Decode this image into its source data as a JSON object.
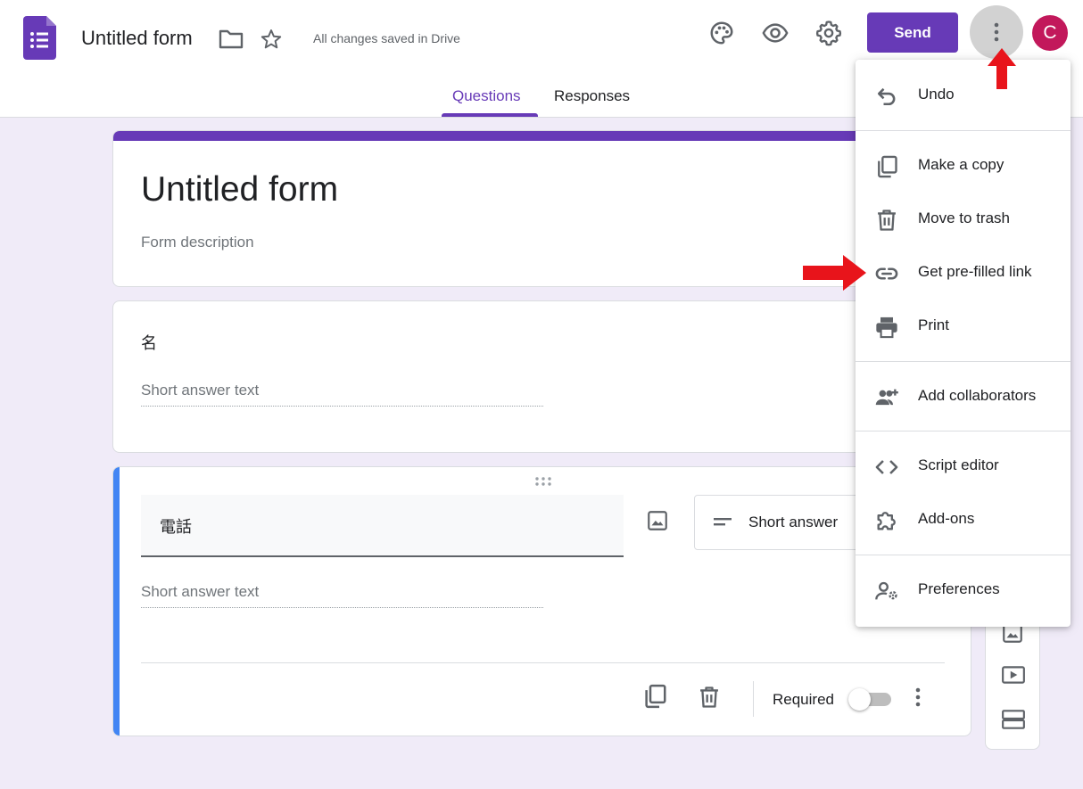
{
  "header": {
    "title": "Untitled form",
    "save_status": "All changes saved in Drive",
    "send_label": "Send",
    "avatar_initial": "C",
    "tabs": [
      {
        "label": "Questions",
        "active": true
      },
      {
        "label": "Responses",
        "active": false
      }
    ]
  },
  "form": {
    "title": "Untitled form",
    "description_placeholder": "Form description"
  },
  "questions": [
    {
      "title": "名",
      "answer_placeholder": "Short answer text"
    },
    {
      "title": "電話",
      "answer_placeholder": "Short answer text",
      "type": "Short answer",
      "required_label": "Required",
      "required": false
    }
  ],
  "menu": {
    "items": [
      {
        "label": "Undo",
        "icon": "undo-icon"
      },
      {
        "label": "Make a copy",
        "icon": "copy-icon"
      },
      {
        "label": "Move to trash",
        "icon": "trash-icon"
      },
      {
        "label": "Get pre-filled link",
        "icon": "link-icon"
      },
      {
        "label": "Print",
        "icon": "print-icon"
      },
      {
        "label": "Add collaborators",
        "icon": "add-people-icon"
      },
      {
        "label": "Script editor",
        "icon": "code-icon"
      },
      {
        "label": "Add-ons",
        "icon": "puzzle-icon"
      },
      {
        "label": "Preferences",
        "icon": "person-settings-icon"
      }
    ]
  },
  "colors": {
    "brand": "#673ab7",
    "accent_blue": "#4285f4",
    "avatar": "#c2185b",
    "annotation_arrow": "#e8141b",
    "background": "#f0ebf8"
  }
}
